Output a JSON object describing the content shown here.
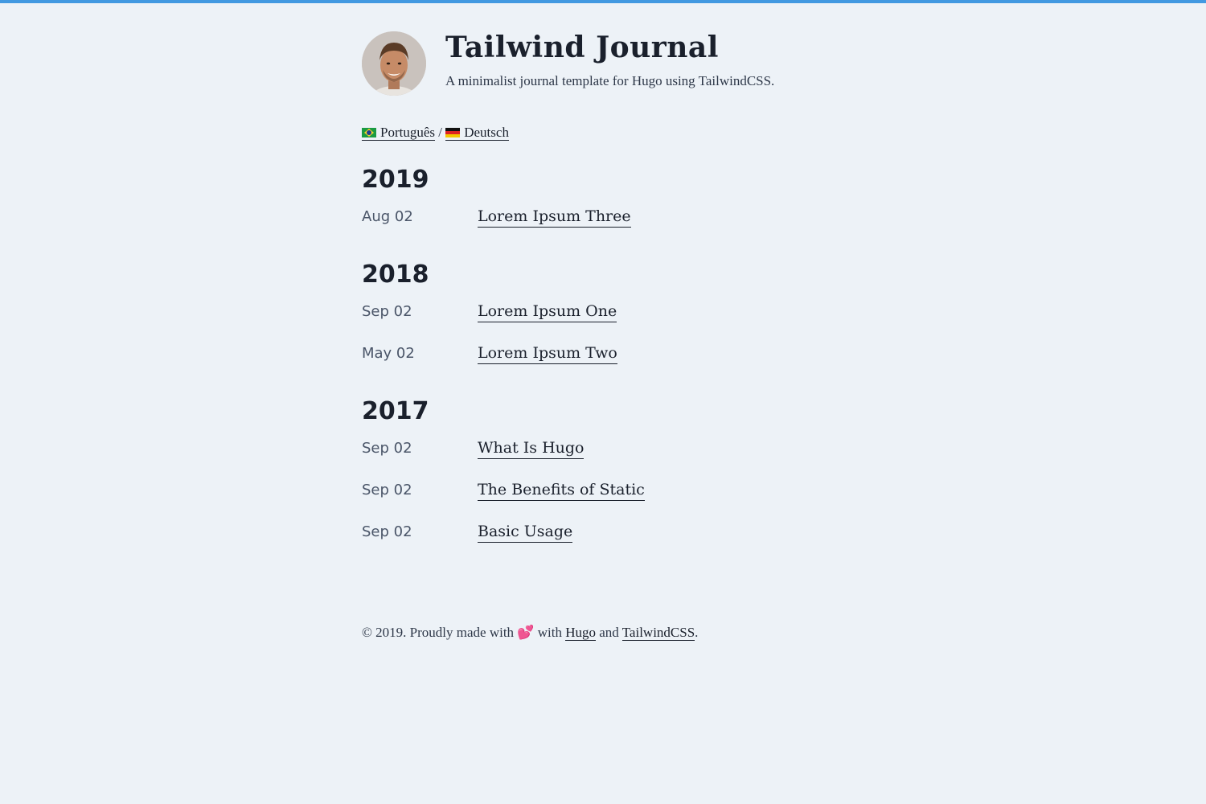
{
  "header": {
    "title": "Tailwind Journal",
    "description": "A minimalist journal template for Hugo using TailwindCSS."
  },
  "languages": {
    "items": [
      {
        "label": "Português",
        "flag": "brazil-flag-icon"
      },
      {
        "label": "Deutsch",
        "flag": "germany-flag-icon"
      }
    ],
    "separator": "/"
  },
  "years": [
    {
      "year": "2019",
      "posts": [
        {
          "date": "Aug 02",
          "title": "Lorem Ipsum Three"
        }
      ]
    },
    {
      "year": "2018",
      "posts": [
        {
          "date": "Sep 02",
          "title": "Lorem Ipsum One"
        },
        {
          "date": "May 02",
          "title": "Lorem Ipsum Two"
        }
      ]
    },
    {
      "year": "2017",
      "posts": [
        {
          "date": "Sep 02",
          "title": "What Is Hugo"
        },
        {
          "date": "Sep 02",
          "title": "The Benefits of Static"
        },
        {
          "date": "Sep 02",
          "title": "Basic Usage"
        }
      ]
    }
  ],
  "footer": {
    "prefix": "© 2019. Proudly made with",
    "heart": "💕",
    "with": "with",
    "hugo_link": "Hugo",
    "and": "and",
    "tailwind_link": "TailwindCSS",
    "suffix": "."
  },
  "colors": {
    "accent_bar": "#4299e1",
    "background": "#edf2f7",
    "text": "#1a202c"
  }
}
